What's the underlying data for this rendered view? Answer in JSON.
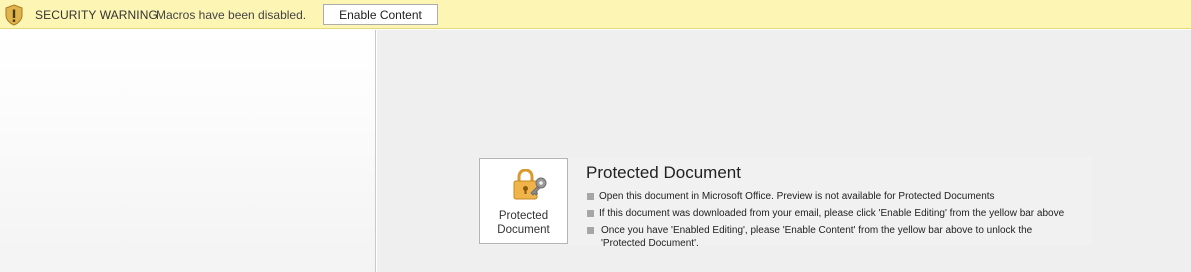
{
  "security_bar": {
    "icon": "shield-exclamation-icon",
    "title": "SECURITY WARNING",
    "message": "Macros have been disabled.",
    "enable_button_label": "Enable Content",
    "background_color": "#fdf5b4"
  },
  "protected_card": {
    "icon": "padlock-key-icon",
    "icon_label_line1": "Protected",
    "icon_label_line2": "Document",
    "title": "Protected Document",
    "bullets": [
      "Open this document in Microsoft Office. Preview is not available for Protected Documents",
      "If this document was downloaded from your email, please click 'Enable Editing' from the yellow bar above",
      "Once you have 'Enabled Editing', please 'Enable Content' from the yellow bar above to unlock the",
      "'Protected Document'."
    ]
  }
}
